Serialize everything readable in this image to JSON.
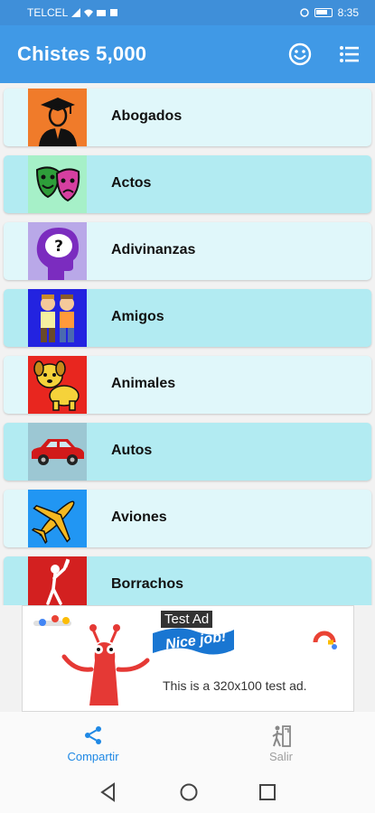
{
  "status_bar": {
    "carrier": "TELCEL",
    "time": "8:35"
  },
  "app_bar": {
    "title": "Chistes 5,000",
    "emoji_icon": "smiley-icon",
    "menu_icon": "list-icon"
  },
  "categories": [
    {
      "label": "Abogados",
      "bg": "#e0f7fa",
      "thumb": "#f07b2a"
    },
    {
      "label": "Actos",
      "bg": "#b2ebf2",
      "thumb": "#a6f0c8"
    },
    {
      "label": "Adivinanzas",
      "bg": "#e0f7fa",
      "thumb": "#b9a8e8"
    },
    {
      "label": "Amigos",
      "bg": "#b2ebf2",
      "thumb": "#2323e0"
    },
    {
      "label": "Animales",
      "bg": "#e0f7fa",
      "thumb": "#e8261f"
    },
    {
      "label": "Autos",
      "bg": "#b2ebf2",
      "thumb": "#9cc7d3"
    },
    {
      "label": "Aviones",
      "bg": "#e0f7fa",
      "thumb": "#2196f3"
    },
    {
      "label": "Borrachos",
      "bg": "#b2ebf2",
      "thumb": "#d32020"
    }
  ],
  "ad": {
    "badge": "Test Ad",
    "banner": "Nice job!",
    "text": "This is a 320x100 test ad."
  },
  "bottom_nav": {
    "share_label": "Compartir",
    "exit_label": "Salir",
    "active_color": "#1e88e5",
    "inactive_color": "#9e9e9e"
  },
  "colors": {
    "app_bar": "#4099e6",
    "status_bar": "#3f8fd9"
  }
}
